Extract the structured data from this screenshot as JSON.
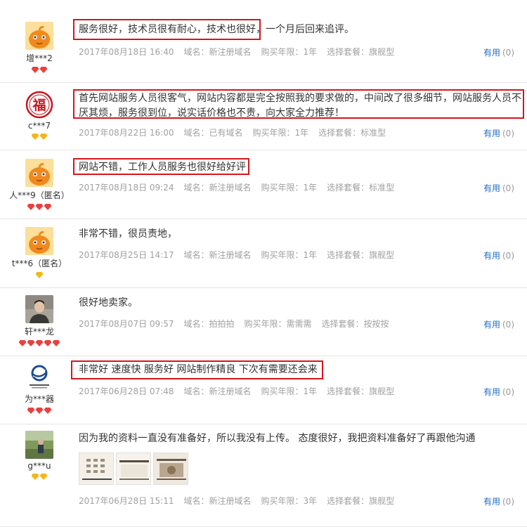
{
  "helpful_label": "有用",
  "reviews": [
    {
      "user": "增***2",
      "comment": "服务很好，技术员很有耐心，技术也很好，一个月后回来追评。",
      "date": "2017年08月18日 16:40",
      "domain": "域名：新注册域名",
      "years": "购买年限：1年",
      "package": "选择套餐：旗舰型",
      "helpful_count": "(0)",
      "badge_count": 2,
      "badge_color": "#e8413f",
      "avatar": "orange-mascot-avatar"
    },
    {
      "user": "c***7",
      "comment": "首先网站服务人员很客气，网站内容都是完全按照我的要求做的，中间改了很多细节，网站服务人员不厌其烦，服务很到位，说实话价格也不贵，向大家全力推荐！",
      "date": "2017年08月22日 16:00",
      "domain": "域名：已有域名",
      "years": "购买年限：1年",
      "package": "选择套餐：标准型",
      "helpful_count": "(0)",
      "badge_count": 2,
      "badge_color": "#f3b817",
      "avatar": "fu-character-avatar",
      "avatar_glyph": "福"
    },
    {
      "user": "人***9（匿名）",
      "comment": "网站不错，工作人员服务也很好给好评",
      "date": "2017年08月18日 09:24",
      "domain": "域名：新注册域名",
      "years": "购买年限：1年",
      "package": "选择套餐：标准型",
      "helpful_count": "(0)",
      "badge_count": 3,
      "badge_color": "#e8413f",
      "avatar": "orange-mascot-avatar"
    },
    {
      "user": "t***6（匿名）",
      "comment": "非常不错，很员责地，",
      "date": "2017年08月25日 14:17",
      "domain": "域名：新注册域名",
      "years": "购买年限：1年",
      "package": "选择套餐：旗舰型",
      "helpful_count": "(0)",
      "badge_count": 1,
      "badge_color": "#f3b817",
      "avatar": "orange-mascot-avatar"
    },
    {
      "user": "轩***龙",
      "comment": "很好地卖家。",
      "date": "2017年08月07日 09:57",
      "domain": "域名：拍拍拍",
      "years": "购买年限：需需需",
      "package": "选择套餐：按按按",
      "helpful_count": "(0)",
      "badge_count": 5,
      "badge_color": "#e8413f",
      "avatar": "person-photo-avatar"
    },
    {
      "user": "为***器",
      "comment": "非常好 速度快 服务好 网站制作精良 下次有需要还会来",
      "date": "2017年06月28日 07:48",
      "domain": "域名：新注册域名",
      "years": "购买年限：1年",
      "package": "选择套餐：旗舰型",
      "helpful_count": "(0)",
      "badge_count": 3,
      "badge_color": "#e8413f",
      "avatar": "company-logo-avatar"
    },
    {
      "user": "g***u",
      "comment": "因为我的资料一直没有准备好，所以我没有上传。 态度很好，我把资料准备好了再跟他沟通",
      "date": "2017年06月28日 15:11",
      "domain": "域名：新注册域名",
      "years": "购买年限：3年",
      "package": "选择套餐：旗舰型",
      "helpful_count": "(0)",
      "badge_count": 2,
      "badge_color": "#f3b817",
      "avatar": "outdoor-photo-avatar"
    }
  ]
}
